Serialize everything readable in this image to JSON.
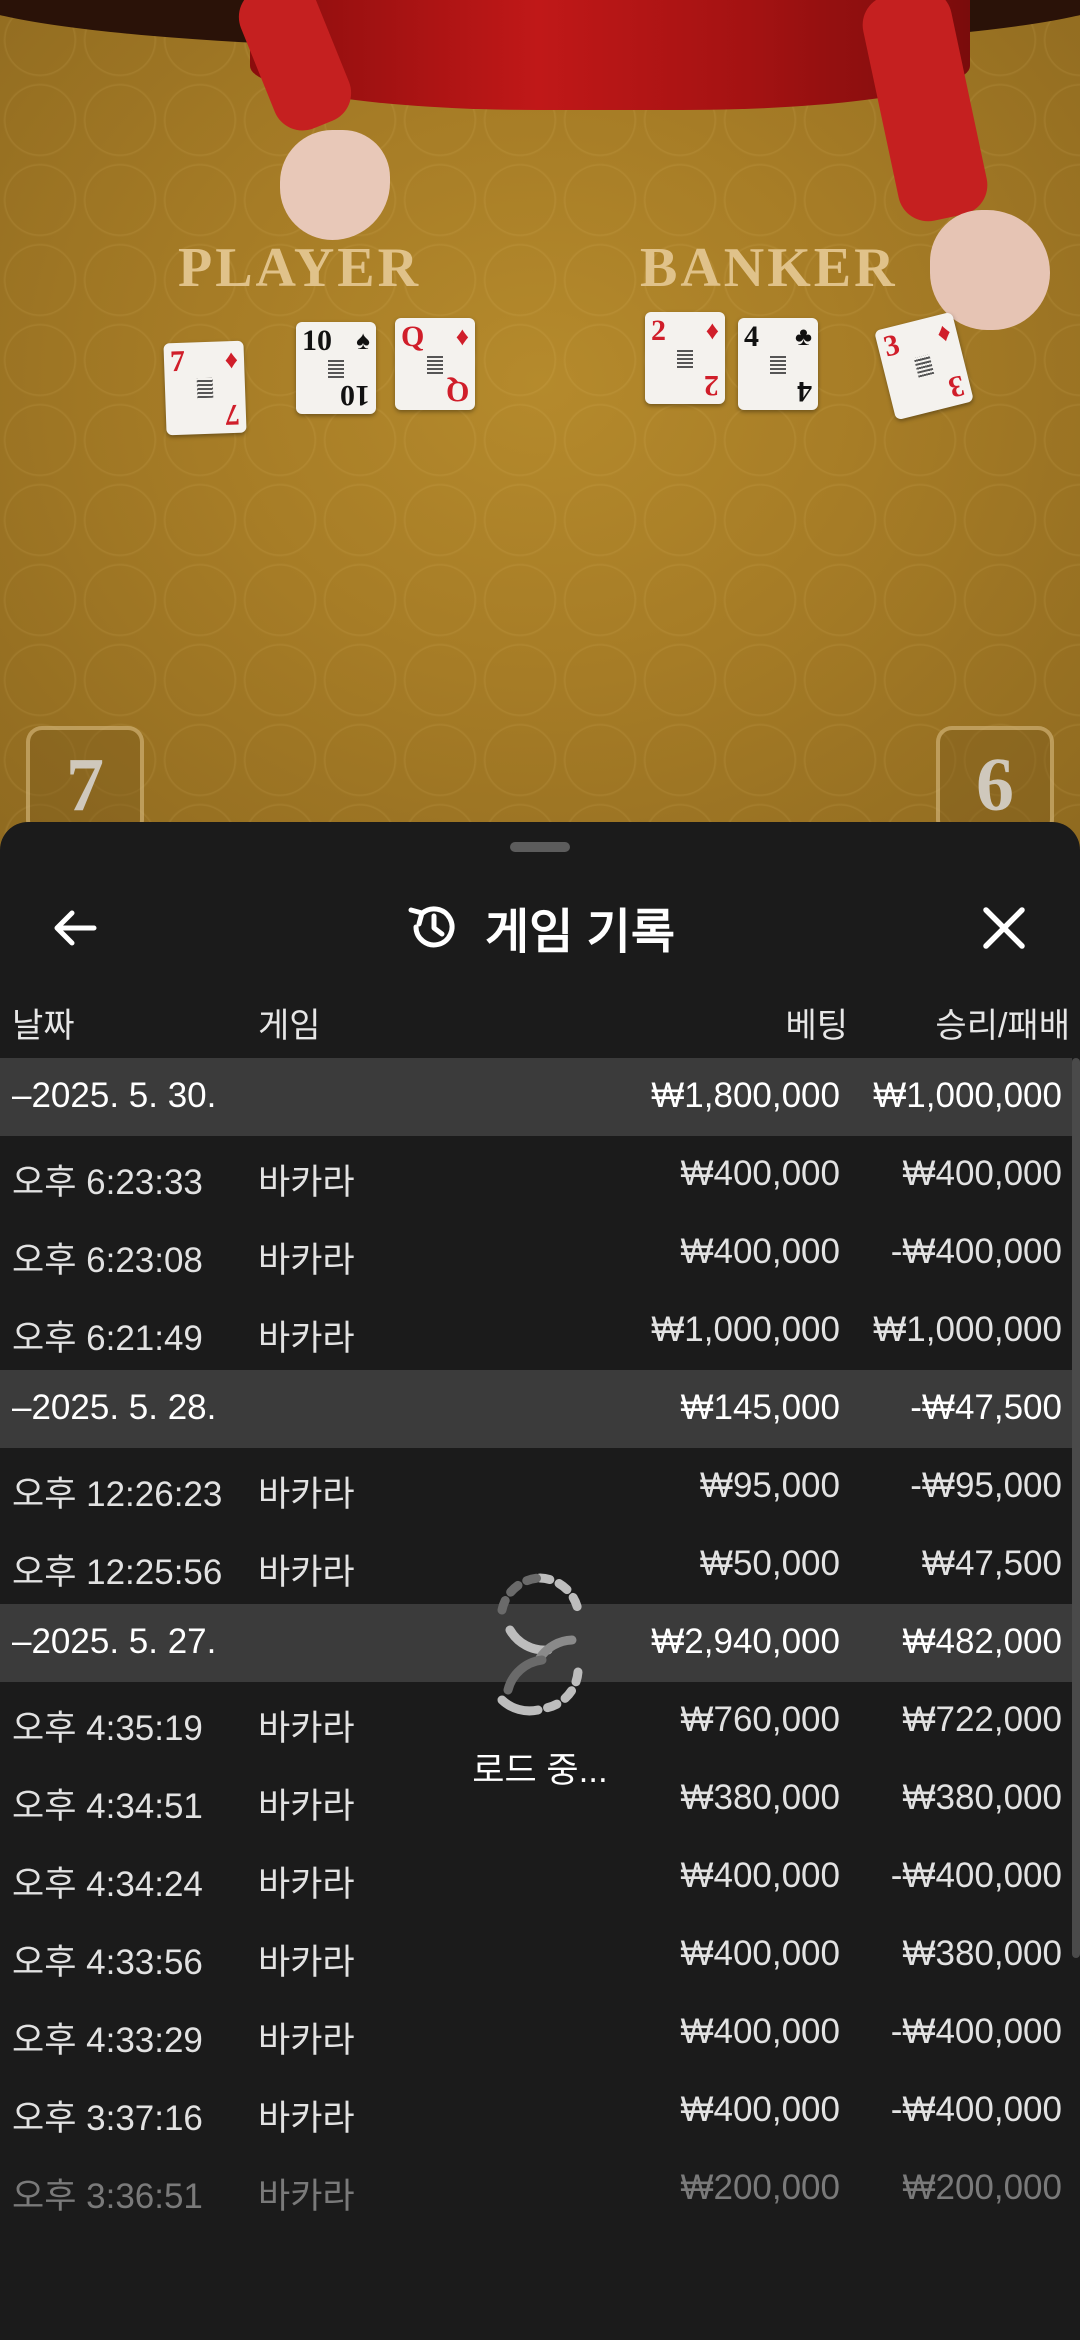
{
  "game_view": {
    "player_label": "PLAYER",
    "banker_label": "BANKER",
    "player_score": "7",
    "banker_score": "6",
    "player_cards": [
      {
        "rank": "7",
        "suit": "♦",
        "color": "red"
      },
      {
        "rank": "10",
        "suit": "♠",
        "color": "black"
      },
      {
        "rank": "Q",
        "suit": "♦",
        "color": "red"
      }
    ],
    "banker_cards": [
      {
        "rank": "2",
        "suit": "♦",
        "color": "red"
      },
      {
        "rank": "4",
        "suit": "♣",
        "color": "black"
      },
      {
        "rank": "3",
        "suit": "♦",
        "color": "red"
      }
    ]
  },
  "header": {
    "title": "게임 기록",
    "back_icon": "arrow-left-icon",
    "history_icon": "history-icon",
    "close_icon": "close-icon"
  },
  "columns": {
    "date": "날짜",
    "game": "게임",
    "bet": "베팅",
    "result": "승리/패배"
  },
  "rows": [
    {
      "type": "group",
      "date": "–2025. 5. 30.",
      "game": "",
      "bet": "₩1,800,000",
      "result": "₩1,000,000"
    },
    {
      "type": "item",
      "date": "오후 6:23:33",
      "game": "바카라",
      "bet": "₩400,000",
      "result": "₩400,000"
    },
    {
      "type": "item",
      "date": "오후 6:23:08",
      "game": "바카라",
      "bet": "₩400,000",
      "result": "-₩400,000"
    },
    {
      "type": "item",
      "date": "오후 6:21:49",
      "game": "바카라",
      "bet": "₩1,000,000",
      "result": "₩1,000,000"
    },
    {
      "type": "group",
      "date": "–2025. 5. 28.",
      "game": "",
      "bet": "₩145,000",
      "result": "-₩47,500"
    },
    {
      "type": "item",
      "date": "오후 12:26:23",
      "game": "바카라",
      "bet": "₩95,000",
      "result": "-₩95,000"
    },
    {
      "type": "item",
      "date": "오후 12:25:56",
      "game": "바카라",
      "bet": "₩50,000",
      "result": "₩47,500"
    },
    {
      "type": "group",
      "date": "–2025. 5. 27.",
      "game": "",
      "bet": "₩2,940,000",
      "result": "₩482,000"
    },
    {
      "type": "item",
      "date": "오후 4:35:19",
      "game": "바카라",
      "bet": "₩760,000",
      "result": "₩722,000"
    },
    {
      "type": "item",
      "date": "오후 4:34:51",
      "game": "바카라",
      "bet": "₩380,000",
      "result": "₩380,000"
    },
    {
      "type": "item",
      "date": "오후 4:34:24",
      "game": "바카라",
      "bet": "₩400,000",
      "result": "-₩400,000"
    },
    {
      "type": "item",
      "date": "오후 4:33:56",
      "game": "바카라",
      "bet": "₩400,000",
      "result": "₩380,000"
    },
    {
      "type": "item",
      "date": "오후 4:33:29",
      "game": "바카라",
      "bet": "₩400,000",
      "result": "-₩400,000"
    },
    {
      "type": "item",
      "date": "오후 3:37:16",
      "game": "바카라",
      "bet": "₩400,000",
      "result": "-₩400,000"
    },
    {
      "type": "item",
      "date": "오후 3:36:51",
      "game": "바카라",
      "bet": "₩200,000",
      "result": "₩200,000",
      "faded": true
    }
  ],
  "loading": {
    "text": "로드 중...",
    "icon": "loading-spinner-icon"
  }
}
